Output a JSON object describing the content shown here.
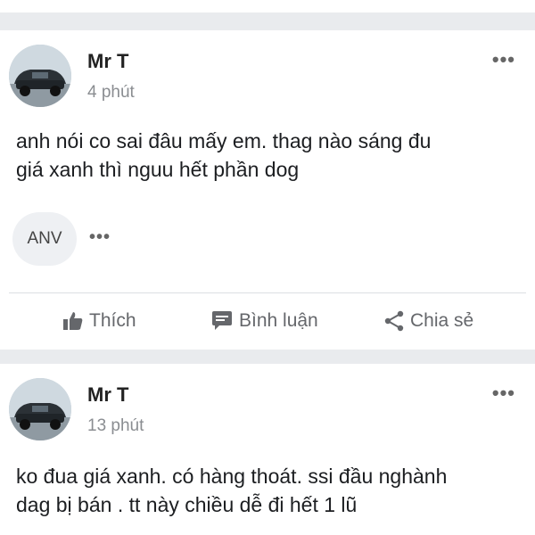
{
  "posts": [
    {
      "author": "Mr T",
      "time": "4 phút",
      "more_label": "•••",
      "text_line1": "anh nói co sai đâu mấy em. thag nào sáng đu",
      "text_line2": "giá xanh thì nguu hết phần dog",
      "reaction_label": "ANV",
      "reaction_more_label": "•••",
      "actions": {
        "like": "Thích",
        "comment": "Bình luận",
        "share": "Chia sẻ"
      }
    },
    {
      "author": "Mr T",
      "time": "13 phút",
      "more_label": "•••",
      "text_line1": "ko đua giá xanh. có hàng thoát. ssi đầu nghành",
      "text_line2": "dag  bị bán . tt này chiều dễ đi hết 1 lũ"
    }
  ],
  "colors": {
    "background": "#ffffff",
    "divider": "#e9ebee",
    "secondary_text": "#65676b"
  },
  "icons": [
    "like-icon",
    "comment-icon",
    "share-icon",
    "more-options-icon"
  ]
}
